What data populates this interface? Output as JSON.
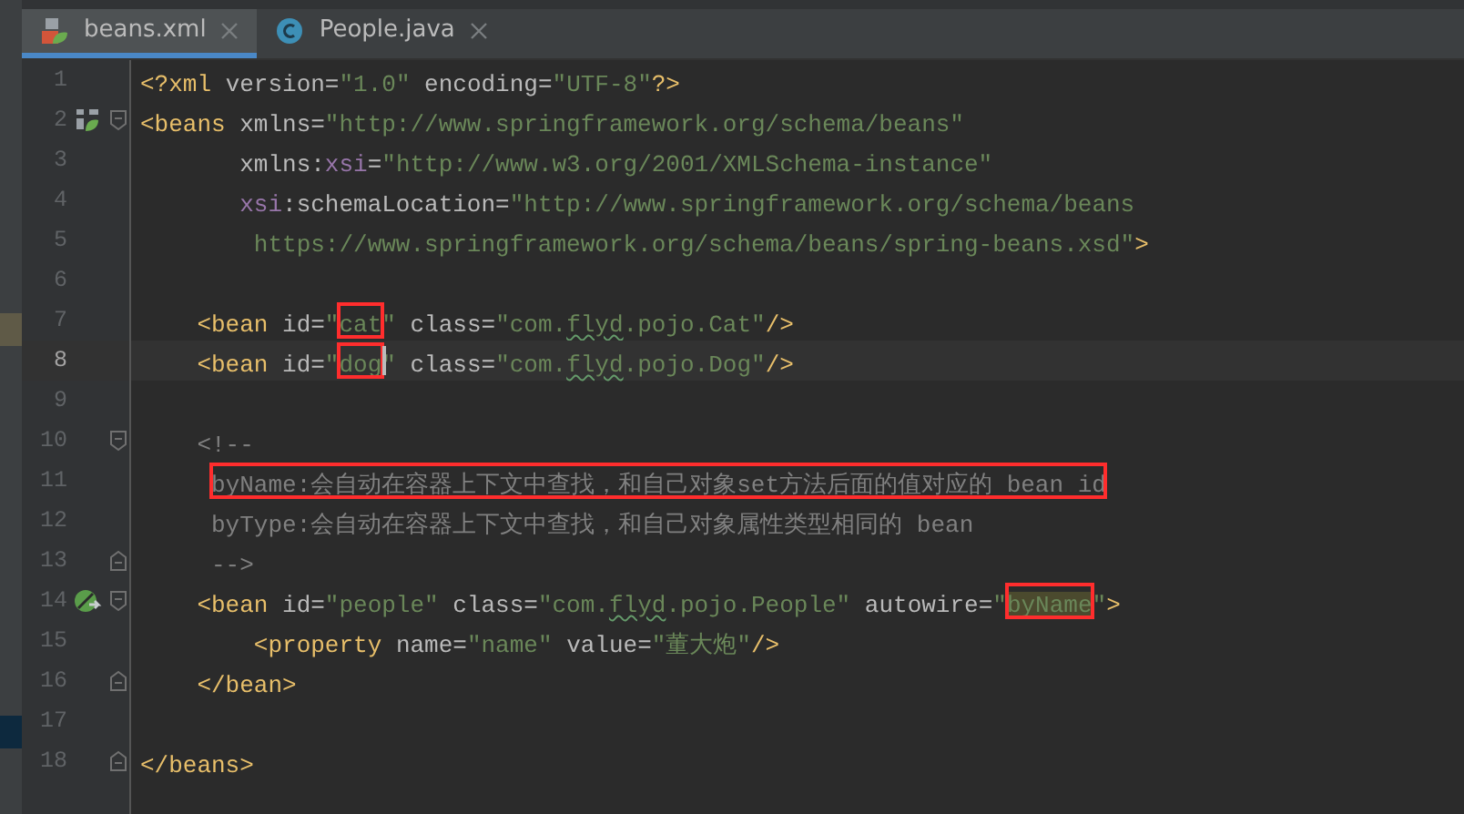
{
  "tabs": [
    {
      "label": "beans.xml",
      "kind": "xml",
      "selected": true
    },
    {
      "label": "People.java",
      "kind": "class",
      "selected": false
    }
  ],
  "lines": [
    {
      "number": "1",
      "tokens": [
        {
          "text": "<?xml ",
          "kind": "tag"
        },
        {
          "text": "version=",
          "kind": "attr"
        },
        {
          "text": "\"1.0\"",
          "kind": "str"
        },
        {
          "text": " encoding=",
          "kind": "attr"
        },
        {
          "text": "\"UTF-8\"",
          "kind": "str"
        },
        {
          "text": "?>",
          "kind": "tag"
        }
      ]
    },
    {
      "number": "2",
      "config_marker": true,
      "fold_open": true,
      "tokens": [
        {
          "text": "<beans ",
          "kind": "tag"
        },
        {
          "text": "xmlns=",
          "kind": "attr"
        },
        {
          "text": "\"http://www.springframework.org/schema/beans\"",
          "kind": "str"
        }
      ]
    },
    {
      "number": "3",
      "tokens": [
        {
          "text": "       xmlns:",
          "kind": "attr"
        },
        {
          "text": "xsi",
          "kind": "ns"
        },
        {
          "text": "=",
          "kind": "attr"
        },
        {
          "text": "\"http://www.w3.org/2001/XMLSchema-instance\"",
          "kind": "str"
        }
      ]
    },
    {
      "number": "4",
      "tokens": [
        {
          "text": "       xsi",
          "kind": "ns"
        },
        {
          "text": ":schemaLocation=",
          "kind": "attr"
        },
        {
          "text": "\"http://www.springframework.org/schema/beans",
          "kind": "str"
        }
      ]
    },
    {
      "number": "5",
      "tokens": [
        {
          "text": "        https://www.springframework.org/schema/beans/spring-beans.xsd\"",
          "kind": "str"
        },
        {
          "text": ">",
          "kind": "tag"
        }
      ]
    },
    {
      "number": "6"
    },
    {
      "number": "7",
      "tokens": [
        {
          "text": "    <bean ",
          "kind": "tag"
        },
        {
          "text": "id=",
          "kind": "attr"
        },
        {
          "text": "\"",
          "kind": "str"
        },
        {
          "text": "cat",
          "kind": "str",
          "boxed": true
        },
        {
          "text": "\"",
          "kind": "str"
        },
        {
          "text": " class=",
          "kind": "attr"
        },
        {
          "text": "\"com.",
          "kind": "str"
        },
        {
          "text": "flyd",
          "kind": "str",
          "typo": true
        },
        {
          "text": ".pojo.Cat\"",
          "kind": "str"
        },
        {
          "text": "/>",
          "kind": "tag"
        }
      ]
    },
    {
      "number": "8",
      "current": true,
      "tokens": [
        {
          "text": "    <bean ",
          "kind": "tag"
        },
        {
          "text": "id=",
          "kind": "attr"
        },
        {
          "text": "\"",
          "kind": "str"
        },
        {
          "text": "dog",
          "kind": "str",
          "boxed": true,
          "caret": true
        },
        {
          "text": "\"",
          "kind": "str"
        },
        {
          "text": " class=",
          "kind": "attr"
        },
        {
          "text": "\"com.",
          "kind": "str"
        },
        {
          "text": "flyd",
          "kind": "str",
          "typo": true
        },
        {
          "text": ".pojo.Dog\"",
          "kind": "str"
        },
        {
          "text": "/>",
          "kind": "tag"
        }
      ]
    },
    {
      "number": "9"
    },
    {
      "number": "10",
      "fold_open": true,
      "tokens": [
        {
          "text": "    <!--",
          "kind": "comment"
        }
      ]
    },
    {
      "number": "11",
      "tokens": [
        {
          "text": "     byName:会自动在容器上下文中查找，和自己对象set方法后面的值对应的 bean id",
          "kind": "comment",
          "boxed": true
        }
      ]
    },
    {
      "number": "12",
      "tokens": [
        {
          "text": "     byType:会自动在容器上下文中查找，和自己对象属性类型相同的 bean",
          "kind": "comment"
        }
      ]
    },
    {
      "number": "13",
      "fold_close": true,
      "tokens": [
        {
          "text": "     -->",
          "kind": "comment"
        }
      ]
    },
    {
      "number": "14",
      "autowire_marker": true,
      "fold_open": true,
      "tokens": [
        {
          "text": "    <bean ",
          "kind": "tag"
        },
        {
          "text": "id=",
          "kind": "attr"
        },
        {
          "text": "\"people\"",
          "kind": "str"
        },
        {
          "text": " class=",
          "kind": "attr"
        },
        {
          "text": "\"com.",
          "kind": "str"
        },
        {
          "text": "flyd",
          "kind": "str",
          "typo": true
        },
        {
          "text": ".pojo.People\"",
          "kind": "str"
        },
        {
          "text": " autowire=",
          "kind": "attr"
        },
        {
          "text": "\"",
          "kind": "str"
        },
        {
          "text": "byName",
          "kind": "str",
          "boxed": true,
          "selected": true
        },
        {
          "text": "\"",
          "kind": "str"
        },
        {
          "text": ">",
          "kind": "tag"
        }
      ]
    },
    {
      "number": "15",
      "tokens": [
        {
          "text": "        <property ",
          "kind": "tag"
        },
        {
          "text": "name=",
          "kind": "attr"
        },
        {
          "text": "\"name\"",
          "kind": "str"
        },
        {
          "text": " value=",
          "kind": "attr"
        },
        {
          "text": "\"董大炮\"",
          "kind": "str"
        },
        {
          "text": "/>",
          "kind": "tag"
        }
      ]
    },
    {
      "number": "16",
      "fold_close": true,
      "tokens": [
        {
          "text": "    </bean>",
          "kind": "tag"
        }
      ]
    },
    {
      "number": "17"
    },
    {
      "number": "18",
      "fold_close": true,
      "tokens": [
        {
          "text": "</beans>",
          "kind": "tag"
        }
      ]
    }
  ]
}
